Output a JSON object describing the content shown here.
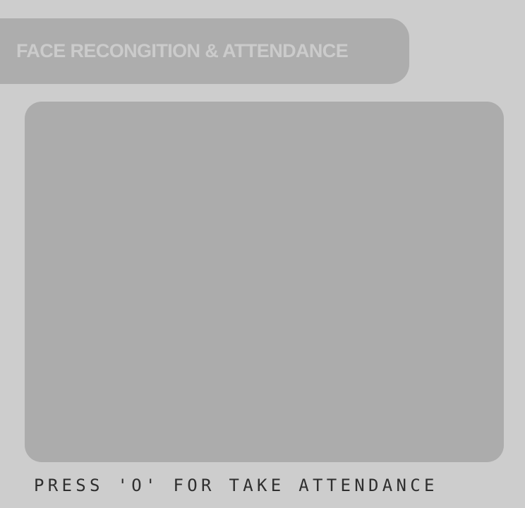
{
  "header": {
    "title": "FACE RECONGITION & ATTENDANCE"
  },
  "main": {
    "camera_feed_state": "empty"
  },
  "footer": {
    "instruction": "PRESS 'O' FOR TAKE ATTENDANCE"
  },
  "colors": {
    "background": "#cdcdcd",
    "banner": "#adadad",
    "banner_text": "#cbcbcb",
    "feed_panel": "#acacac",
    "instruction_text": "#2e2e2e"
  }
}
